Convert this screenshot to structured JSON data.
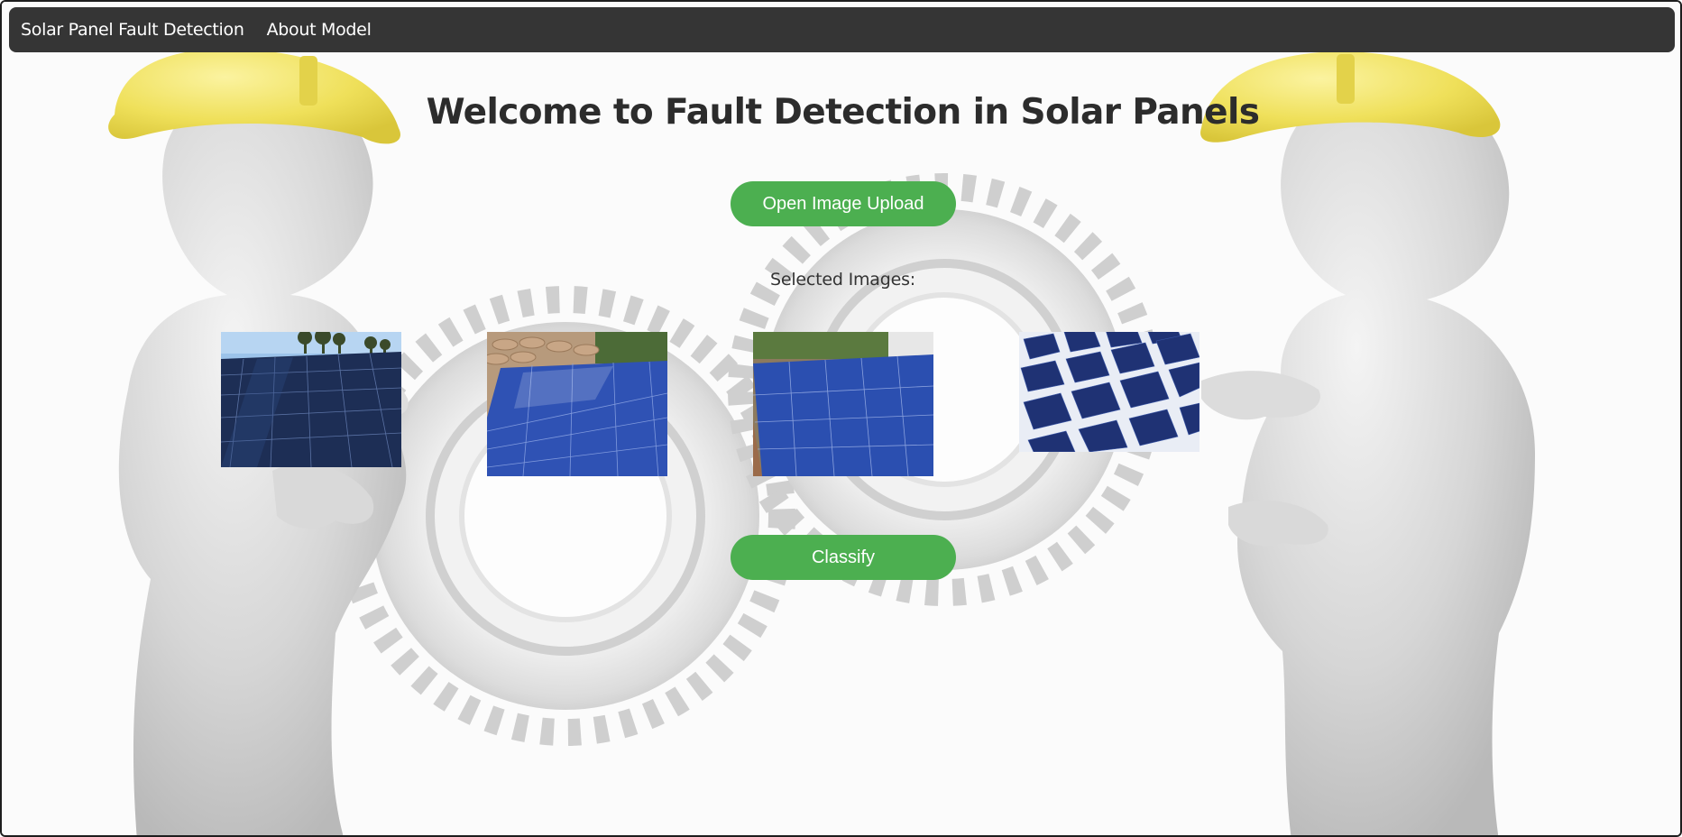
{
  "navbar": {
    "items": [
      {
        "label": "Solar Panel Fault Detection"
      },
      {
        "label": "About Model"
      }
    ]
  },
  "main": {
    "title": "Welcome to Fault Detection in Solar Panels",
    "upload_button_label": "Open Image Upload",
    "selected_images_label": "Selected Images:",
    "classify_button_label": "Classify"
  },
  "colors": {
    "navbar_bg": "#353535",
    "button_bg": "#4caf50",
    "button_text": "#ffffff",
    "title_text": "#2c2c2c",
    "helmet_yellow": "#f2e24e",
    "panel_blue": "#2f4fa8"
  },
  "selected_images": [
    {
      "kind": "ground-solar-array-under-sky"
    },
    {
      "kind": "rooftop-solar-panels-with-tiles"
    },
    {
      "kind": "rooftop-solar-panels-closeup"
    },
    {
      "kind": "monocrystalline-cells-closeup"
    }
  ],
  "background": {
    "kind": "two-3d-figures-with-hard-hats-holding-gears"
  }
}
